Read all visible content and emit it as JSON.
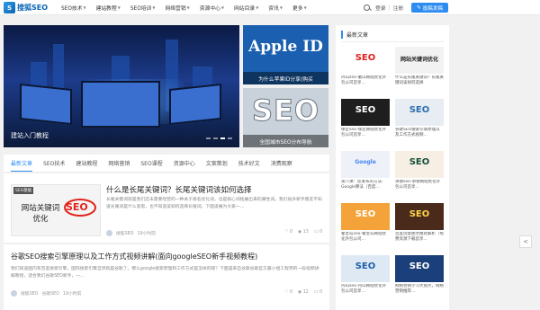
{
  "header": {
    "logo_text": "搜狐SEO",
    "nav": [
      {
        "label": "SEO技术",
        "caret": true
      },
      {
        "label": "建站教程",
        "caret": true
      },
      {
        "label": "SEO培训",
        "caret": true
      },
      {
        "label": "网络营销",
        "caret": true
      },
      {
        "label": "资源中心",
        "caret": true
      },
      {
        "label": "网站目录",
        "caret": true
      },
      {
        "label": "资讯",
        "caret": true
      },
      {
        "label": "更多",
        "caret": true
      }
    ],
    "login": "登录",
    "register": "注册",
    "post_button": "投稿发稿"
  },
  "hero": {
    "main_caption": "建站入门教程",
    "tile1_big": "Apple ID",
    "tile1_caption": "为什么苹果ID分享(购买",
    "tile2_big": "SEO",
    "tile2_caption": "全国城市SEO分布导航"
  },
  "tabs": [
    "最新文章",
    "SEO技术",
    "建站教程",
    "网络营销",
    "SEO课程",
    "资源中心",
    "文案策划",
    "技术好文",
    "消费观察"
  ],
  "posts": [
    {
      "badge": "SEO基础",
      "thumb_text": "网站关键词优化",
      "thumb_seo": "SEO",
      "title": "什么是长尾关键词？长尾关键词该如何选择",
      "excerpt": "长尾关键词就是我们还未需要经营的一种关于排名优化词，也是核心词拓展出来的属性词。我们很多新手朋友不知道长尾词是什么意思，也不知道该如何选择长尾词。下面凌展为大家一…",
      "author": "搜狐SEO",
      "time": "19小时前",
      "likes": "0",
      "comments": "0",
      "views": "13"
    },
    {
      "title": "谷歌SEO搜索引擎原理以及工作方式视频讲解(面向googleSEO新手视频教程)",
      "excerpt": "我们知道国内有百度搜索引擎，国际搜索引擎自然就是谷歌了。那么google搜索原理和工作方式是怎样的呢？下面是来自谷歌谷歌官方最小组工程师的一段视频讲解教程，适合我们谷歌SEO新手，一…",
      "author": "搜狐SEO",
      "category": "谷歌SEO",
      "time": "19小时前",
      "likes": "0",
      "comments": "0",
      "views": "12"
    }
  ],
  "sidebar": {
    "heading": "最新文章",
    "cards": [
      {
        "label": "SEO",
        "text": "丹山seo-衢山网站优化外包公司首享…",
        "bg": "#ffffff",
        "fg": "#e0231b"
      },
      {
        "label": "网站关键词优化",
        "text": "什么是长尾关键词？长尾关键词该如何选择",
        "bg": "#f2f2f2",
        "fg": "#222222"
      },
      {
        "label": "SEO",
        "text": "保定seo-保定网站优化外包公司首享…",
        "bg": "#1e1e1e",
        "fg": "#ffffff"
      },
      {
        "label": "SEO",
        "text": "谷歌SEO搜索引擎原理以及工作方式视频…",
        "bg": "#e7edf2",
        "fg": "#2d6fb0"
      },
      {
        "label": "Google",
        "text": "第八课：您发布的方法-Google算法（百度…",
        "bg": "#eef2f8",
        "fg": "#4285f4"
      },
      {
        "label": "SEO",
        "text": "承德seo-承德网站优化外包公司首享…",
        "bg": "#f7efe4",
        "fg": "#14503a"
      },
      {
        "label": "SEO",
        "text": "秦皇岛seo-秦皇岛网站优化外包公司…",
        "bg": "#f4a23a",
        "fg": "#ffffff"
      },
      {
        "label": "SEO",
        "text": "百度创意图文模式解析（免费资源下载首享…",
        "bg": "#4a2a1a",
        "fg": "#ffd34a"
      },
      {
        "label": "SEO",
        "text": "丹山seo-丹山网站优化外包公司首享…",
        "bg": "#dfe9f4",
        "fg": "#1d5fa8"
      },
      {
        "label": "SEO",
        "text": "网络营销学习大盘点，网络营销推荐…",
        "bg": "#1b3f7a",
        "fg": "#ffffff"
      }
    ]
  },
  "colors": {
    "accent": "#2d8cf0"
  },
  "icons": [
    "search-icon",
    "share-icon",
    "like-icon",
    "comment-icon",
    "view-icon"
  ]
}
